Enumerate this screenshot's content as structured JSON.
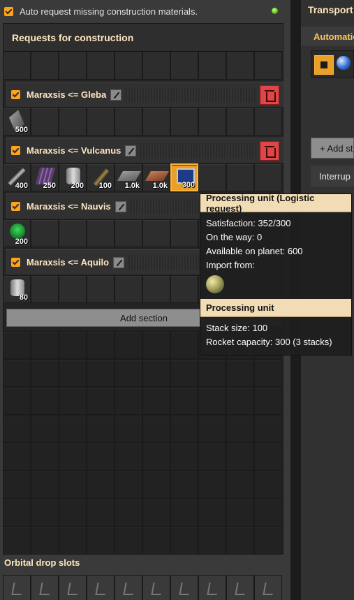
{
  "header": {
    "auto_request_label": "Auto request missing construction materials."
  },
  "requests": {
    "title": "Requests for construction",
    "add_section_label": "Add section",
    "sections": [
      {
        "name": "Maraxsis <= Gleba",
        "items": [
          {
            "icon": "steel-plate-icon",
            "qty": "500"
          }
        ]
      },
      {
        "name": "Maraxsis <= Vulcanus",
        "items": [
          {
            "icon": "iron-stick-icon",
            "qty": "400"
          },
          {
            "icon": "holmium-plate-icon",
            "qty": "250"
          },
          {
            "icon": "lubricant-barrel-icon",
            "qty": "200"
          },
          {
            "icon": "capsule-icon",
            "qty": "100"
          },
          {
            "icon": "concrete-icon",
            "qty": "1.0k"
          },
          {
            "icon": "brick-icon",
            "qty": "1.0k"
          },
          {
            "icon": "processing-unit-icon",
            "qty": "300"
          }
        ]
      },
      {
        "name": "Maraxsis <= Nauvis",
        "items": [
          {
            "icon": "green-barrel-icon",
            "qty": "200"
          }
        ]
      },
      {
        "name": "Maraxsis <= Aquilo",
        "items": [
          {
            "icon": "fluid-barrel-icon",
            "qty": "80"
          }
        ]
      }
    ]
  },
  "orbital": {
    "title": "Orbital drop slots"
  },
  "tooltip": {
    "header1": "Processing unit (Logistic request)",
    "satisfaction": "Satisfaction: 352/300",
    "on_the_way": "On the way: 0",
    "available": "Available on planet: 600",
    "import_from": "Import from:",
    "header2": "Processing unit",
    "stack_size": "Stack size: 100",
    "rocket_capacity": "Rocket capacity: 300 (3 stacks)"
  },
  "right_panel": {
    "title": "Transport",
    "tab": "Automatio",
    "add_button": "+ Add st",
    "interrupt_label": "Interrup"
  }
}
